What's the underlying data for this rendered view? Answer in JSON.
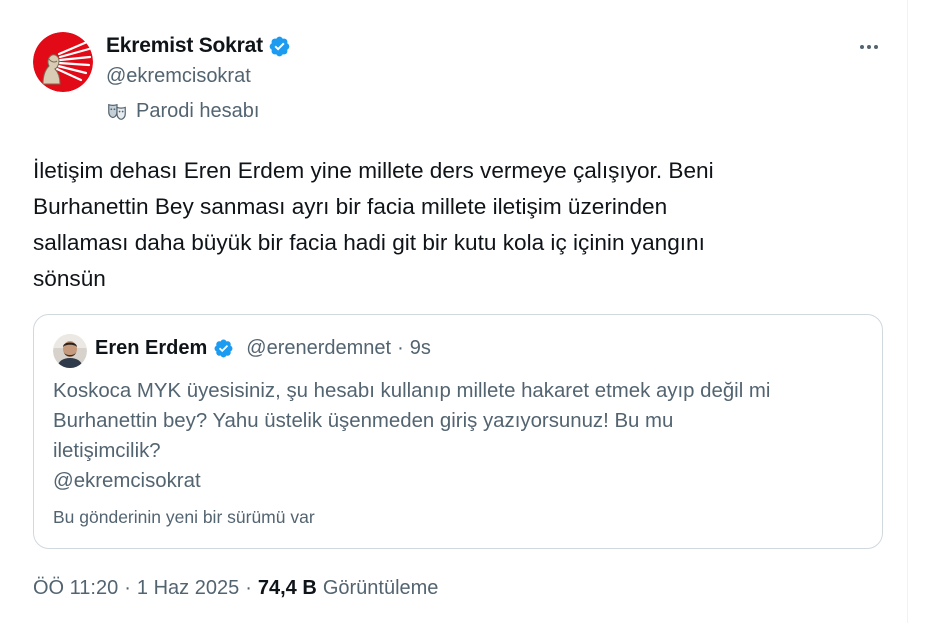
{
  "tweet": {
    "author": {
      "name": "Ekremist Sokrat",
      "handle": "@ekremcisokrat",
      "verified": true,
      "avatar_color": "#e30a17"
    },
    "parody_label": "Parodi hesabı",
    "text_lines": [
      "İletişim dehası Eren Erdem yine millete ders vermeye çalışıyor. Beni",
      "Burhanettin Bey sanması ayrı bir facia millete iletişim üzerinden",
      "sallaması daha büyük bir facia hadi git bir kutu kola iç içinin yangını",
      "sönsün"
    ],
    "quote": {
      "author_name": "Eren Erdem",
      "handle": "@erenerdemnet",
      "separator": "·",
      "time": "9s",
      "text_lines": [
        "Koskoca MYK üyesisiniz, şu hesabı kullanıp millete hakaret etmek ayıp değil mi",
        "Burhanettin bey? Yahu üstelik üşenmeden giriş yazıyorsunuz! Bu mu",
        "iletişimcilik?",
        "@ekremcisokrat"
      ],
      "note": "Bu gönderinin yeni bir sürümü var"
    },
    "meta": {
      "time": "ÖÖ 11:20",
      "sep1": "·",
      "date": "1 Haz 2025",
      "sep2": "·",
      "views_count": "74,4 B",
      "views_label": "Görüntüleme"
    }
  },
  "icons": {
    "verified": "verified-badge-icon",
    "parody": "parody-mask-icon",
    "more": "more-horizontal-icon"
  },
  "colors": {
    "verified_blue": "#1d9bf0",
    "secondary_text": "#536471",
    "primary_text": "#0f1419",
    "border": "#cfd9de"
  }
}
